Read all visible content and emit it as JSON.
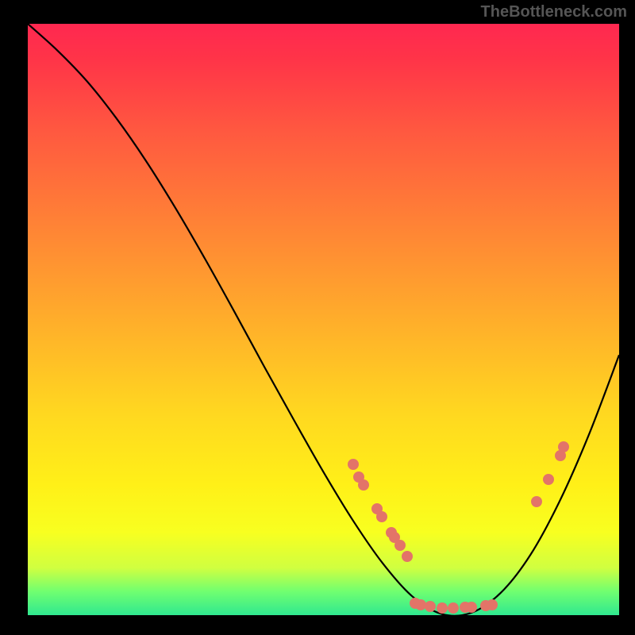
{
  "attribution": "TheBottleneck.com",
  "chart_data": {
    "type": "line",
    "title": "",
    "xlabel": "",
    "ylabel": "",
    "xlim": [
      0,
      100
    ],
    "ylim": [
      0,
      100
    ],
    "series": [
      {
        "name": "curve",
        "color": "#000000",
        "x": [
          0,
          5,
          10,
          15,
          20,
          25,
          30,
          35,
          40,
          45,
          50,
          55,
          60,
          65,
          70,
          75,
          80,
          85,
          90,
          95,
          100
        ],
        "y": [
          100,
          95.5,
          90.3,
          84,
          76.8,
          68.8,
          60.2,
          51.2,
          42,
          33,
          24.2,
          16,
          8.8,
          3.2,
          0.2,
          0.4,
          3.8,
          10.2,
          19.4,
          30.8,
          44
        ]
      }
    ],
    "markers": {
      "color": "#e37468",
      "radius_px": 7,
      "points": [
        {
          "x": 55,
          "y": 25.5
        },
        {
          "x": 56,
          "y": 23.3
        },
        {
          "x": 56.8,
          "y": 22.0
        },
        {
          "x": 59,
          "y": 18.0
        },
        {
          "x": 59.8,
          "y": 16.6
        },
        {
          "x": 61.5,
          "y": 14.0
        },
        {
          "x": 62.0,
          "y": 13.2
        },
        {
          "x": 63.0,
          "y": 11.8
        },
        {
          "x": 64.2,
          "y": 10.0
        },
        {
          "x": 65.5,
          "y": 2.0
        },
        {
          "x": 66.5,
          "y": 1.8
        },
        {
          "x": 68.0,
          "y": 1.5
        },
        {
          "x": 70.0,
          "y": 1.2
        },
        {
          "x": 72.0,
          "y": 1.2
        },
        {
          "x": 74.0,
          "y": 1.3
        },
        {
          "x": 75.0,
          "y": 1.3
        },
        {
          "x": 77.5,
          "y": 1.6
        },
        {
          "x": 78.5,
          "y": 1.7
        },
        {
          "x": 86.0,
          "y": 19.2
        },
        {
          "x": 88.0,
          "y": 23.0
        },
        {
          "x": 90.0,
          "y": 27.0
        },
        {
          "x": 90.6,
          "y": 28.4
        }
      ]
    },
    "background_gradient": {
      "top": "#ff2850",
      "bottom": "#30e890"
    }
  }
}
